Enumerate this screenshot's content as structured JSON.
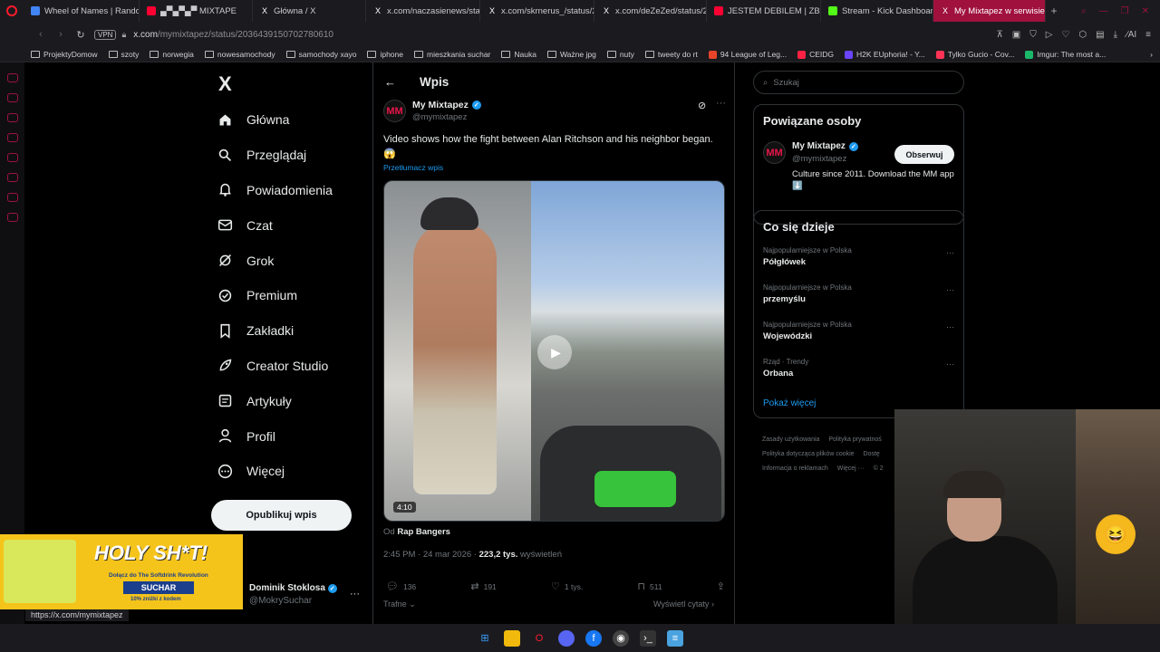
{
  "browser": {
    "tabs": [
      {
        "label": "Wheel of Names | Random",
        "color": "#4285f4"
      },
      {
        "label": "▄▀▄▀▄▀ MIXTAPE",
        "color": "#ff0033"
      },
      {
        "label": "Główna / X",
        "color": "#ffffff"
      },
      {
        "label": "x.com/naczasienews/sta",
        "color": "#ffffff"
      },
      {
        "label": "x.com/skrnerus_/status/20",
        "color": "#ffffff"
      },
      {
        "label": "x.com/deZeZed/status/20",
        "color": "#ffffff"
      },
      {
        "label": "JESTEM DEBILEM | ZBUG",
        "color": "#ff0033"
      },
      {
        "label": "Stream - Kick Dashboard",
        "color": "#53fc18"
      },
      {
        "label": "My Mixtapez w serwisie X",
        "color": "#ffffff"
      }
    ],
    "address": {
      "vpn": "VPN",
      "domain": "x.com",
      "path": "/mymixtapez/status/2036439150702780610"
    },
    "bookmarks": [
      {
        "label": "ProjektyDomow",
        "type": "folder"
      },
      {
        "label": "szoty",
        "type": "folder"
      },
      {
        "label": "norwegia",
        "type": "folder"
      },
      {
        "label": "nowesamochody",
        "type": "folder"
      },
      {
        "label": "samochody xayo",
        "type": "folder"
      },
      {
        "label": "iphone",
        "type": "folder"
      },
      {
        "label": "mieszkania suchar",
        "type": "folder"
      },
      {
        "label": "Nauka",
        "type": "folder"
      },
      {
        "label": "Ważne jpg",
        "type": "folder"
      },
      {
        "label": "nuty",
        "type": "folder"
      },
      {
        "label": "tweety do rt",
        "type": "folder"
      },
      {
        "label": "94 League of Leg...",
        "type": "site"
      },
      {
        "label": "CEIDG",
        "type": "site"
      },
      {
        "label": "H2K EUphoria! - Y...",
        "type": "site"
      },
      {
        "label": "Tylko Gucio - Cov...",
        "type": "site"
      },
      {
        "label": "Imgur: The most a...",
        "type": "site"
      }
    ],
    "status_url": "https://x.com/mymixtapez"
  },
  "nav": {
    "logo": "X",
    "items": [
      {
        "label": "Główna",
        "icon": "home-icon"
      },
      {
        "label": "Przeglądaj",
        "icon": "search-icon"
      },
      {
        "label": "Powiadomienia",
        "icon": "bell-icon"
      },
      {
        "label": "Czat",
        "icon": "mail-icon"
      },
      {
        "label": "Grok",
        "icon": "grok-icon"
      },
      {
        "label": "Premium",
        "icon": "premium-icon"
      },
      {
        "label": "Zakładki",
        "icon": "bookmark-icon"
      },
      {
        "label": "Creator Studio",
        "icon": "rocket-icon"
      },
      {
        "label": "Artykuły",
        "icon": "article-icon"
      },
      {
        "label": "Profil",
        "icon": "user-icon"
      },
      {
        "label": "Więcej",
        "icon": "more-circle-icon"
      }
    ],
    "post_button": "Opublikuj wpis",
    "account": {
      "name": "Dominik Stoklosa",
      "handle": "@MokrySuchar"
    }
  },
  "ad": {
    "headline": "HOLY SH*T!",
    "line1": "Dołącz do The Softdrink Revolution",
    "code": "SUCHAR",
    "line2": "10% zniżki z kodem"
  },
  "post": {
    "header": "Wpis",
    "author": {
      "name": "My Mixtapez",
      "handle": "@mymixtapez",
      "avatar": "MM"
    },
    "text": "Video shows how the fight between Alan Ritchson and his neighbor began. 😱",
    "translate": "Przetłumacz wpis",
    "duration": "4:10",
    "source_prefix": "Od",
    "source": "Rap Bangers",
    "time": "2:45 PM · 24 mar 2026 ·",
    "views": "223,2 tys.",
    "views_label": "wyświetleń",
    "actions": {
      "replies": "136",
      "reposts": "191",
      "likes": "1 tys.",
      "bookmarks": "511"
    },
    "relevance": "Trafne",
    "quotes": "Wyświetl cytaty"
  },
  "sidebar": {
    "search_placeholder": "Szukaj",
    "related": {
      "title": "Powiązane osoby",
      "name": "My Mixtapez",
      "handle": "@mymixtapez",
      "bio": "Culture since 2011. Download the MM app ⬇️",
      "follow": "Obserwuj"
    },
    "trends": {
      "title": "Co się dzieje",
      "items": [
        {
          "context": "Najpopularniejsze w Polska",
          "name": "Półgłówek"
        },
        {
          "context": "Najpopularniejsze w Polska",
          "name": "przemyślu"
        },
        {
          "context": "Najpopularniejsze w Polska",
          "name": "Wojewódzki"
        },
        {
          "context": "Rząd · Trendy",
          "name": "Orbana"
        }
      ],
      "show_more": "Pokaż więcej"
    },
    "footer": [
      "Zasady użytkowania",
      "Polityka prywatnoś",
      "Polityka dotycząca plików cookie",
      "Dostę",
      "Informacja o reklamach",
      "Więcej ···",
      "© 2"
    ]
  },
  "colors": {
    "accent": "#1d9bf0",
    "tab_active": "#a0113d",
    "background": "#000000"
  }
}
